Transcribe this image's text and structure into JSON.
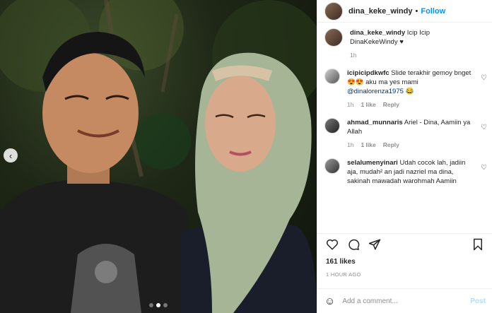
{
  "post": {
    "username": "dina_keke_windy",
    "separator": "•",
    "follow_label": "Follow",
    "caption_user": "dina_keke_windy",
    "caption_text": "Icip Icip DinaKekeWindy ♥",
    "caption_time": "1h",
    "likes": "161 likes",
    "posted": "1 HOUR AGO",
    "comment_placeholder": "Add a comment...",
    "post_label": "Post",
    "carousel": {
      "slide_count": 3,
      "active_slide": 1
    }
  },
  "comments": [
    {
      "user": "icipicipdkwfc",
      "text": "Slide terakhir gemoy bnget 😍😍 aku ma yes mami ",
      "mention": "@dinalorenza1975",
      "text_after": " 😂",
      "time": "1h",
      "likes": "1 like",
      "reply": "Reply"
    },
    {
      "user": "ahmad_munnaris",
      "text": "Ariel - Dina, Aamiin ya Allah",
      "time": "1h",
      "likes": "1 like",
      "reply": "Reply"
    },
    {
      "user": "selalumenyinari",
      "text": "Udah cocok lah, jadiin aja, mudah² an jadi nazriel ma dina, sakinah mawadah warohmah Aamiin",
      "time": "",
      "likes": "",
      "reply": ""
    }
  ],
  "colors": {
    "accent": "#0095f6",
    "text": "#262626",
    "muted": "#8e8e8e",
    "mention": "#00376b",
    "post_disabled": "#b2dffc"
  },
  "icons": {
    "carousel_prev": "chevron-left-icon",
    "like": "heart-icon",
    "comment": "comment-icon",
    "share": "share-icon",
    "save": "bookmark-icon",
    "emoji": "emoji-icon"
  }
}
